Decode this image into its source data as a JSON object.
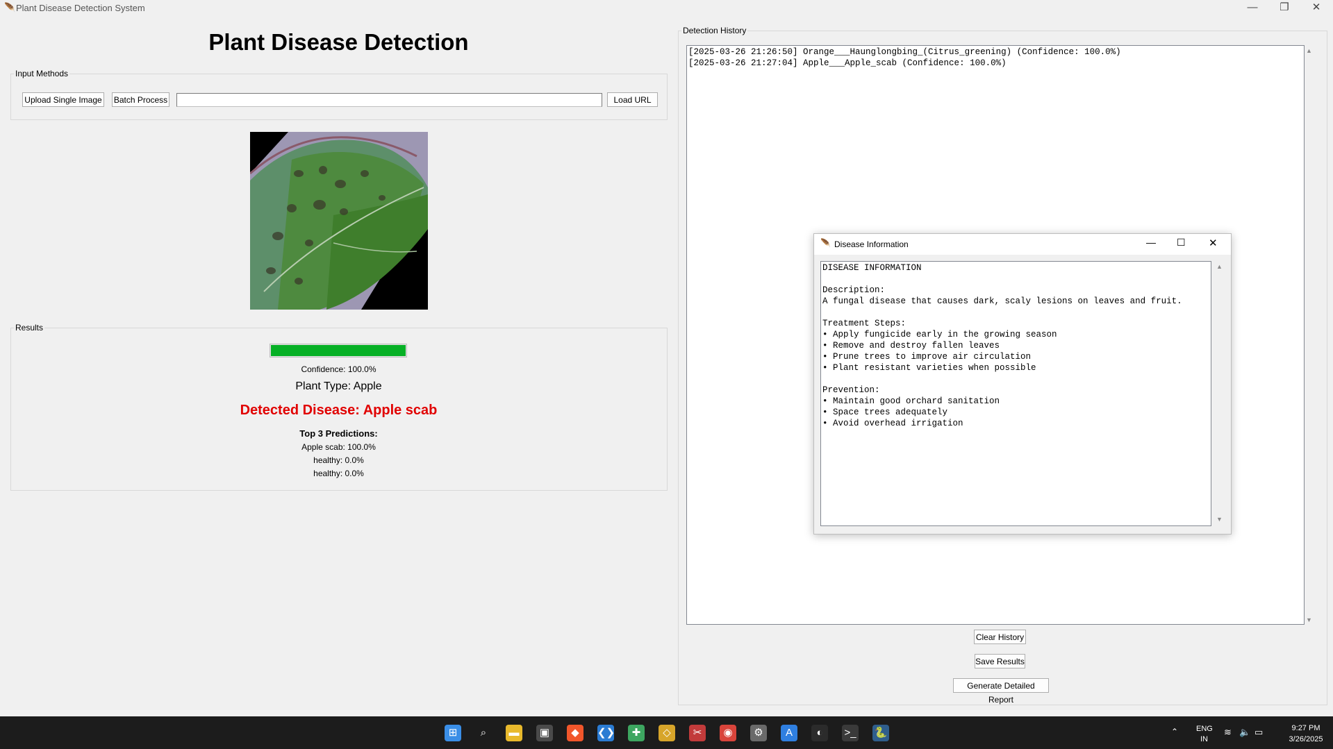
{
  "window": {
    "title": "Plant Disease Detection System",
    "controls": {
      "minimize": "—",
      "maximize": "❐",
      "close": "✕"
    }
  },
  "app": {
    "title": "Plant Disease Detection"
  },
  "input_methods": {
    "legend": "Input Methods",
    "upload_label": "Upload Single Image",
    "batch_label": "Batch Process",
    "url_value": "",
    "load_url_label": "Load URL"
  },
  "results": {
    "legend": "Results",
    "confidence_fraction": 1.0,
    "confidence_text": "Confidence: 100.0%",
    "plant_type": "Plant Type: Apple",
    "detected_disease": "Detected Disease: Apple scab",
    "top3_heading": "Top 3 Predictions:",
    "predictions": [
      "Apple scab: 100.0%",
      "healthy: 0.0%",
      "healthy: 0.0%"
    ],
    "colors": {
      "disease": "#e10000",
      "progress": "#06b025"
    }
  },
  "history": {
    "legend": "Detection History",
    "entries": [
      "[2025-03-26 21:26:50] Orange___Haunglongbing_(Citrus_greening) (Confidence: 100.0%)",
      "[2025-03-26 21:27:04] Apple___Apple_scab (Confidence: 100.0%)"
    ],
    "clear_label": "Clear History",
    "save_label": "Save Results",
    "report_label": "Generate Detailed Report"
  },
  "dialog": {
    "title": "Disease Information",
    "lines": [
      "DISEASE INFORMATION",
      "",
      "Description:",
      "A fungal disease that causes dark, scaly lesions on leaves and fruit.",
      "",
      "Treatment Steps:",
      "• Apply fungicide early in the growing season",
      "• Remove and destroy fallen leaves",
      "• Prune trees to improve air circulation",
      "• Plant resistant varieties when possible",
      "",
      "Prevention:",
      "• Maintain good orchard sanitation",
      "• Space trees adequately",
      "• Avoid overhead irrigation"
    ]
  },
  "taskbar": {
    "icons": [
      "windows-start-icon",
      "search-icon",
      "file-explorer-icon",
      "store-icon",
      "brave-browser-icon",
      "vscode-icon",
      "app-icon",
      "git-icon",
      "snipping-tool-icon",
      "chrome-icon",
      "settings-icon",
      "app-store-icon",
      "github-icon",
      "terminal-icon",
      "python-icon"
    ],
    "lang_top": "ENG",
    "lang_bottom": "IN",
    "time": "9:27 PM",
    "date": "3/26/2025"
  }
}
